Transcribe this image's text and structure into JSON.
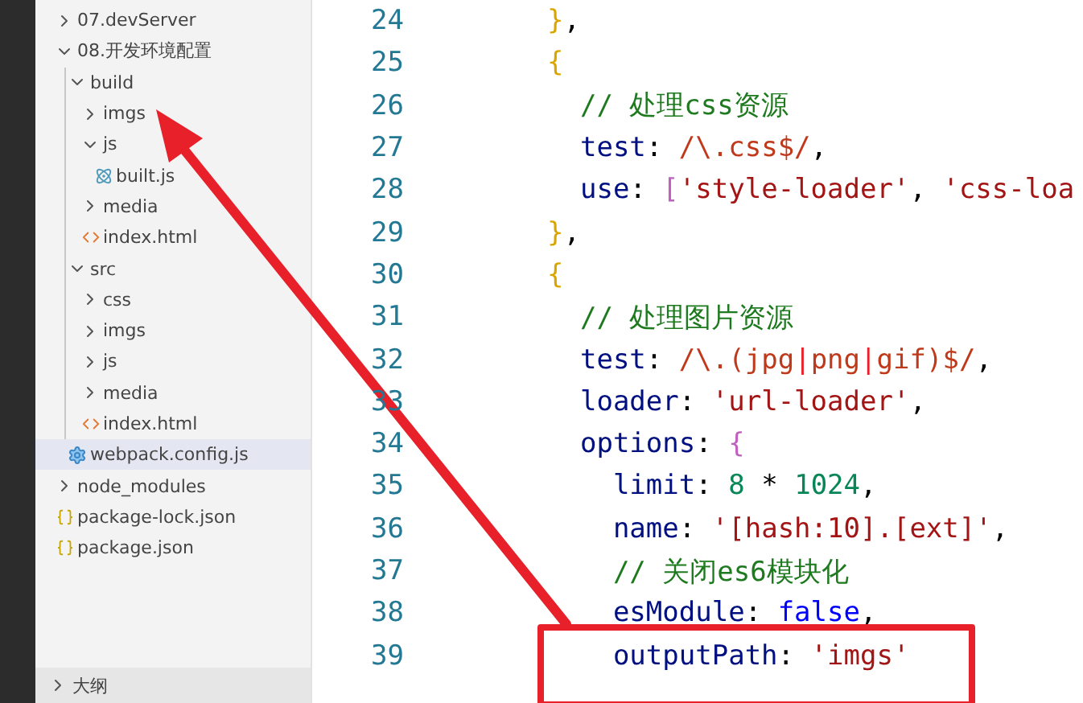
{
  "sidebar": {
    "tree": [
      {
        "label": "07.devServer",
        "kind": "folder",
        "expanded": false,
        "selected": false
      },
      {
        "label": "08.开发环境配置",
        "kind": "folder",
        "expanded": true,
        "selected": false,
        "children": [
          {
            "label": "build",
            "kind": "folder",
            "expanded": true,
            "selected": false,
            "children": [
              {
                "label": "imgs",
                "kind": "folder",
                "expanded": false,
                "selected": false
              },
              {
                "label": "js",
                "kind": "folder",
                "expanded": true,
                "selected": false,
                "children": [
                  {
                    "label": "built.js",
                    "kind": "js",
                    "selected": false
                  }
                ]
              },
              {
                "label": "media",
                "kind": "folder",
                "expanded": false,
                "selected": false
              },
              {
                "label": "index.html",
                "kind": "html",
                "selected": false
              }
            ]
          },
          {
            "label": "src",
            "kind": "folder",
            "expanded": true,
            "selected": false,
            "children": [
              {
                "label": "css",
                "kind": "folder",
                "expanded": false,
                "selected": false
              },
              {
                "label": "imgs",
                "kind": "folder",
                "expanded": false,
                "selected": false
              },
              {
                "label": "js",
                "kind": "folder",
                "expanded": false,
                "selected": false
              },
              {
                "label": "media",
                "kind": "folder",
                "expanded": false,
                "selected": false
              },
              {
                "label": "index.html",
                "kind": "html",
                "selected": false
              }
            ]
          },
          {
            "label": "webpack.config.js",
            "kind": "config",
            "selected": true
          }
        ]
      },
      {
        "label": "node_modules",
        "kind": "folder",
        "expanded": false,
        "selected": false
      },
      {
        "label": "package-lock.json",
        "kind": "json",
        "selected": false
      },
      {
        "label": "package.json",
        "kind": "json",
        "selected": false
      }
    ],
    "outline_panel": {
      "label": "大纲",
      "expanded": false
    }
  },
  "editor": {
    "lines": [
      {
        "number": "24",
        "boxed": false,
        "tokens": [
          {
            "kind": "b1",
            "text": "}"
          },
          {
            "kind": "p",
            "text": ","
          }
        ]
      },
      {
        "number": "25",
        "boxed": false,
        "tokens": [
          {
            "kind": "b1",
            "text": "{"
          }
        ]
      },
      {
        "number": "26",
        "boxed": false,
        "tokens": [
          {
            "kind": "c",
            "text": "  // 处理css资源"
          }
        ]
      },
      {
        "number": "27",
        "boxed": false,
        "tokens": [
          {
            "kind": "k",
            "text": "  test"
          },
          {
            "kind": "p",
            "text": ": "
          },
          {
            "kind": "r",
            "text": "/\\.css$/"
          },
          {
            "kind": "p",
            "text": ","
          }
        ]
      },
      {
        "number": "28",
        "boxed": false,
        "tokens": [
          {
            "kind": "k",
            "text": "  use"
          },
          {
            "kind": "p",
            "text": ": "
          },
          {
            "kind": "b2",
            "text": "["
          },
          {
            "kind": "s",
            "text": "'style-loader'"
          },
          {
            "kind": "p",
            "text": ", "
          },
          {
            "kind": "s",
            "text": "'css-loa"
          }
        ]
      },
      {
        "number": "29",
        "boxed": false,
        "tokens": [
          {
            "kind": "b1",
            "text": "}"
          },
          {
            "kind": "p",
            "text": ","
          }
        ]
      },
      {
        "number": "30",
        "boxed": false,
        "tokens": [
          {
            "kind": "b1",
            "text": "{"
          }
        ]
      },
      {
        "number": "31",
        "boxed": false,
        "tokens": [
          {
            "kind": "c",
            "text": "  // 处理图片资源"
          }
        ]
      },
      {
        "number": "32",
        "boxed": false,
        "tokens": [
          {
            "kind": "k",
            "text": "  test"
          },
          {
            "kind": "p",
            "text": ": "
          },
          {
            "kind": "r",
            "text": "/\\.(jpg"
          },
          {
            "kind": "bar",
            "text": "|"
          },
          {
            "kind": "r",
            "text": "png"
          },
          {
            "kind": "bar",
            "text": "|"
          },
          {
            "kind": "r",
            "text": "gif)$/"
          },
          {
            "kind": "p",
            "text": ","
          }
        ]
      },
      {
        "number": "33",
        "boxed": false,
        "tokens": [
          {
            "kind": "k",
            "text": "  loader"
          },
          {
            "kind": "p",
            "text": ": "
          },
          {
            "kind": "s",
            "text": "'url-loader'"
          },
          {
            "kind": "p",
            "text": ","
          }
        ]
      },
      {
        "number": "34",
        "boxed": false,
        "tokens": [
          {
            "kind": "k",
            "text": "  options"
          },
          {
            "kind": "p",
            "text": ": "
          },
          {
            "kind": "b2",
            "text": "{"
          }
        ]
      },
      {
        "number": "35",
        "boxed": false,
        "tokens": [
          {
            "kind": "k",
            "text": "    limit"
          },
          {
            "kind": "p",
            "text": ": "
          },
          {
            "kind": "n",
            "text": "8"
          },
          {
            "kind": "p",
            "text": " * "
          },
          {
            "kind": "n",
            "text": "1024"
          },
          {
            "kind": "p",
            "text": ","
          }
        ]
      },
      {
        "number": "36",
        "boxed": false,
        "tokens": [
          {
            "kind": "k",
            "text": "    name"
          },
          {
            "kind": "p",
            "text": ": "
          },
          {
            "kind": "s",
            "text": "'[hash:10].[ext]'"
          },
          {
            "kind": "p",
            "text": ","
          }
        ]
      },
      {
        "number": "37",
        "boxed": false,
        "tokens": [
          {
            "kind": "c",
            "text": "    // 关闭es6模块化"
          }
        ]
      },
      {
        "number": "38",
        "boxed": false,
        "tokens": [
          {
            "kind": "k",
            "text": "    esModule"
          },
          {
            "kind": "p",
            "text": ": "
          },
          {
            "kind": "kw",
            "text": "false"
          },
          {
            "kind": "p",
            "text": ","
          }
        ]
      },
      {
        "number": "39",
        "boxed": true,
        "tokens": [
          {
            "kind": "k",
            "text": "    outputPath"
          },
          {
            "kind": "p",
            "text": ": "
          },
          {
            "kind": "s",
            "text": "'imgs'"
          }
        ]
      }
    ]
  },
  "annotations": [
    {
      "kind": "arrow"
    }
  ]
}
